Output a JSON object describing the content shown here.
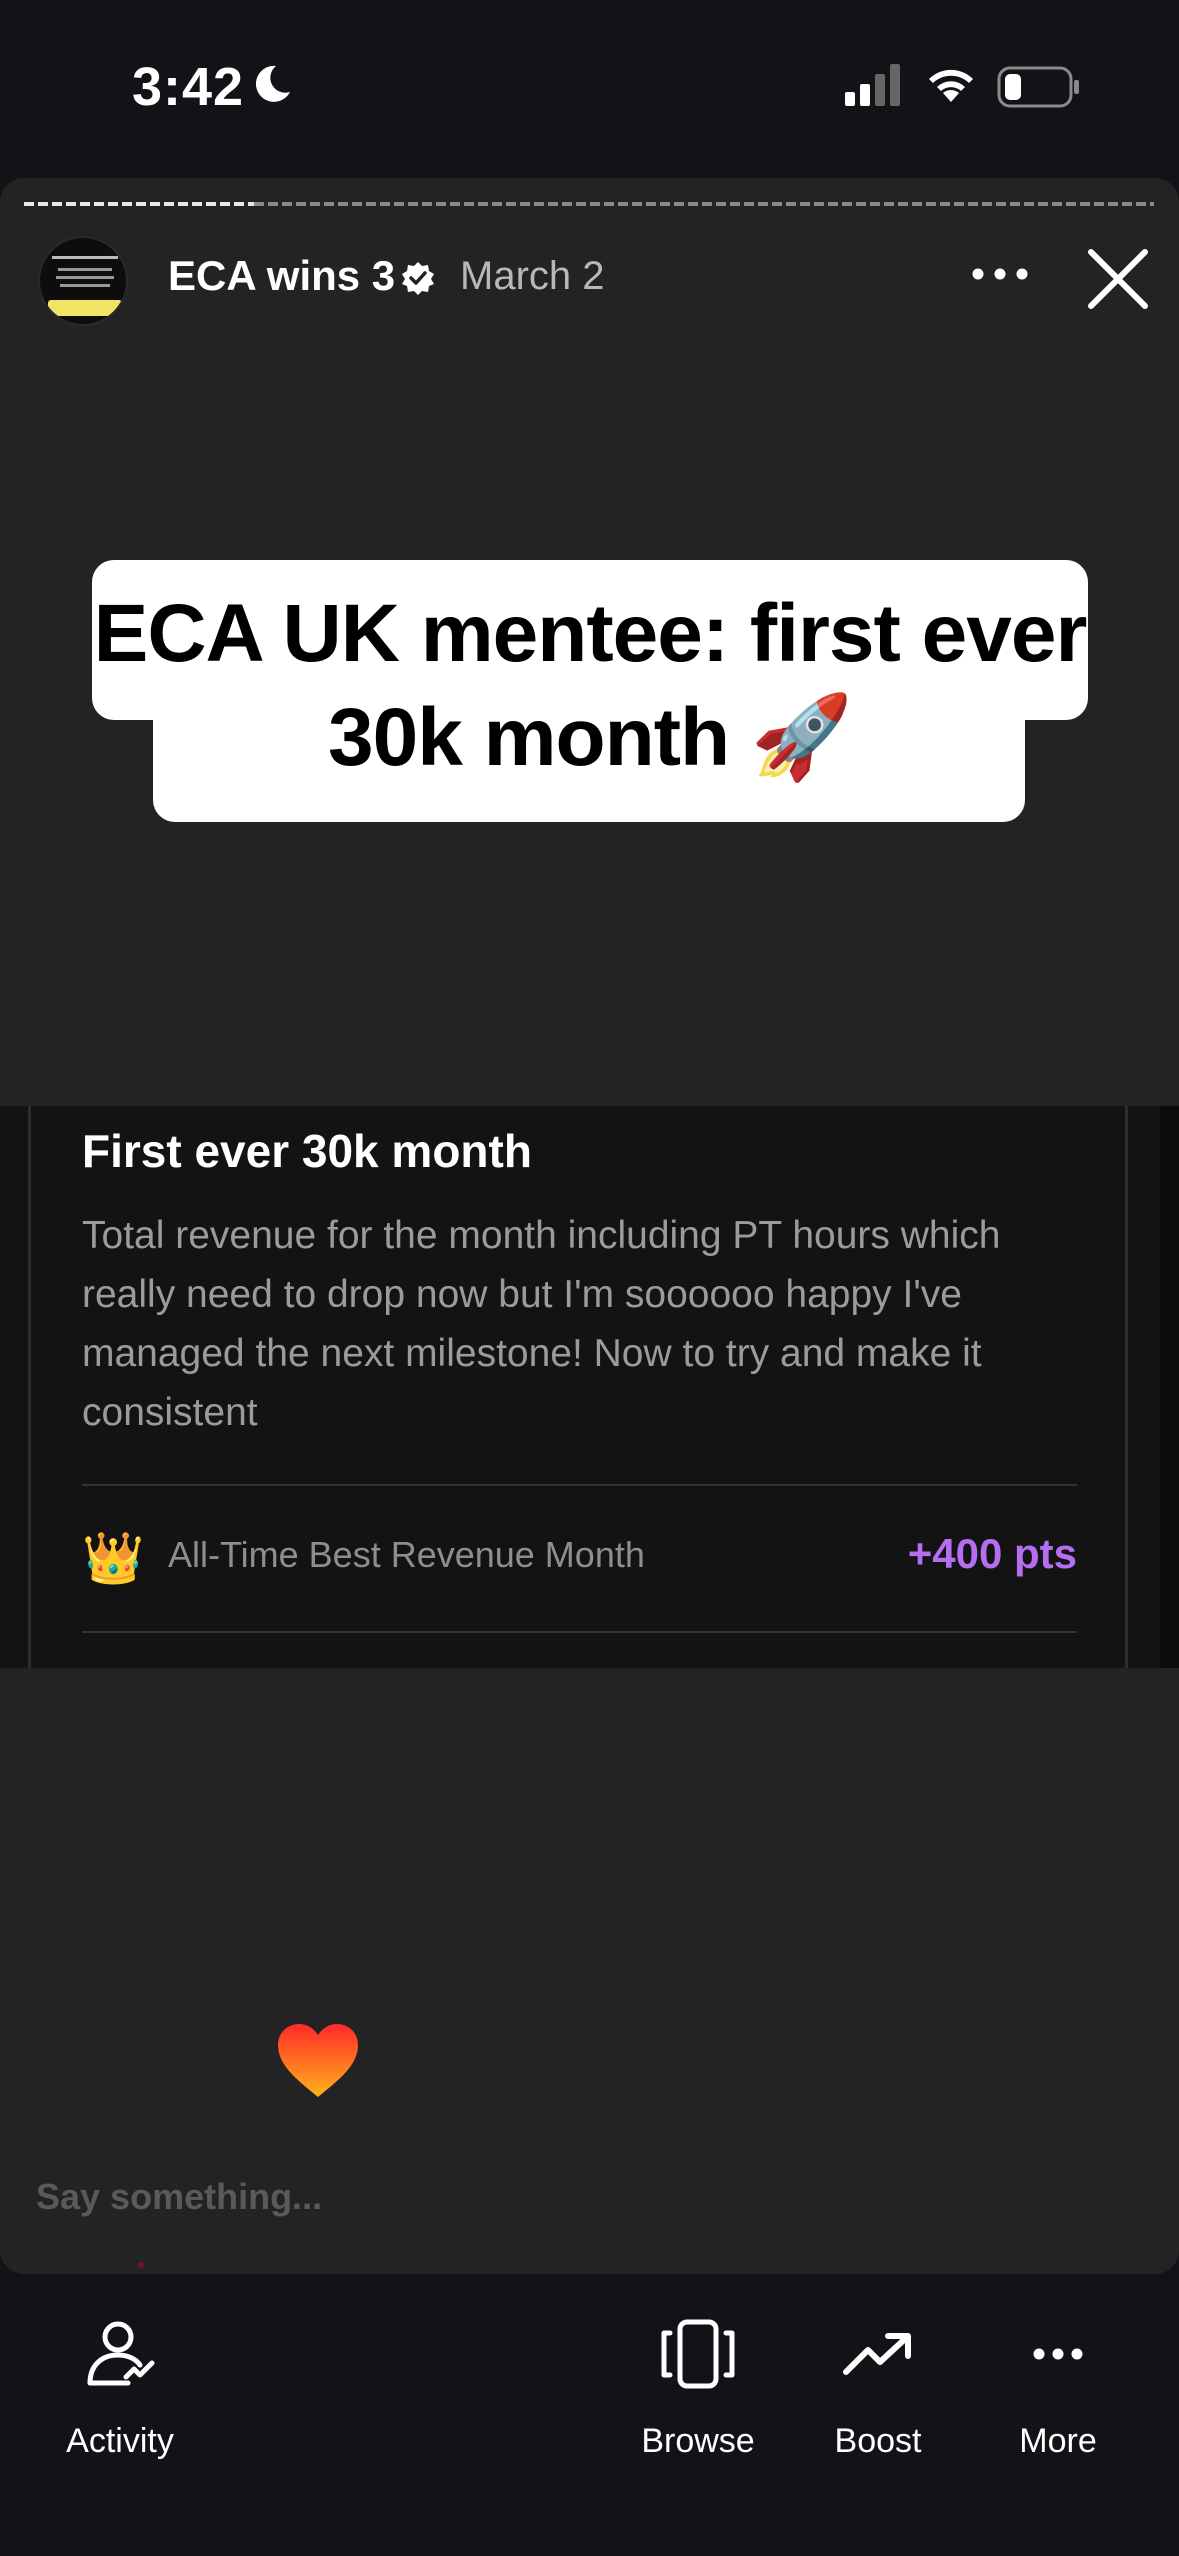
{
  "status_bar": {
    "time": "3:42"
  },
  "story": {
    "author": "ECA wins 3",
    "date": "March 2",
    "caption": "ECA UK mentee: first ever 30k month 🚀",
    "win_card": {
      "title": "First ever 30k month",
      "body": "Total revenue for the month including PT hours which really need to drop now but I'm soooooo happy I've managed the next milestone! Now to try and make it consistent",
      "badge_icon": "👑",
      "badge_label": "All-Time Best Revenue Month",
      "points": "+400 pts",
      "points_color": "#b66ef0"
    },
    "reply": {
      "placeholder": "Say something..."
    }
  },
  "nav": {
    "items": [
      {
        "label": "Activity",
        "icon": "person-activity-icon"
      },
      {
        "label": "Browse",
        "icon": "cards-icon"
      },
      {
        "label": "Boost",
        "icon": "trending-up-icon"
      },
      {
        "label": "More",
        "icon": "ellipsis-icon"
      }
    ]
  }
}
